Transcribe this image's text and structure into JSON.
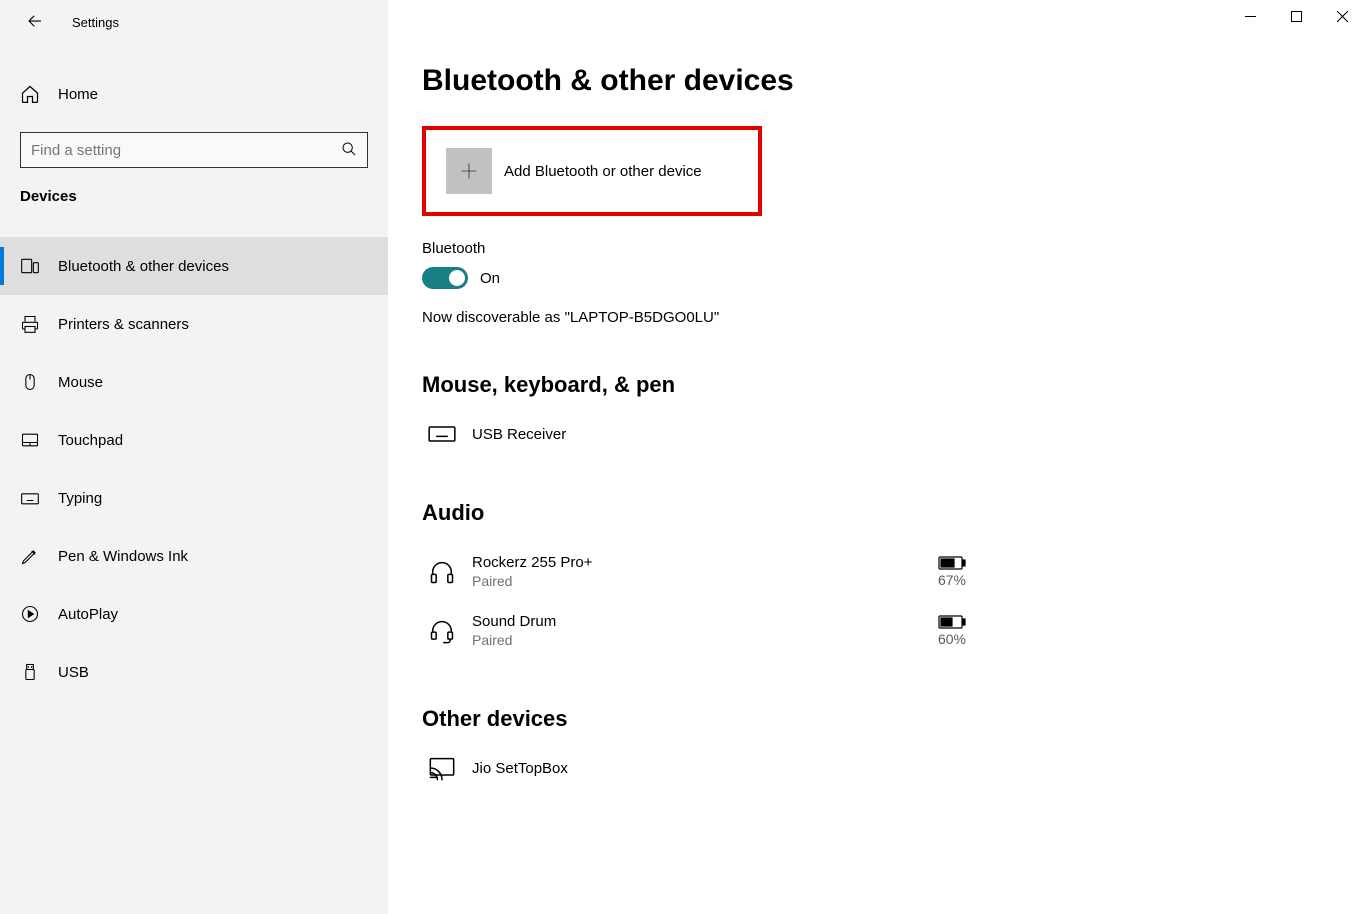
{
  "window": {
    "app_title": "Settings"
  },
  "sidebar": {
    "home_label": "Home",
    "search_placeholder": "Find a setting",
    "category_label": "Devices",
    "items": [
      {
        "label": "Bluetooth & other devices",
        "selected": true
      },
      {
        "label": "Printers & scanners"
      },
      {
        "label": "Mouse"
      },
      {
        "label": "Touchpad"
      },
      {
        "label": "Typing"
      },
      {
        "label": "Pen & Windows Ink"
      },
      {
        "label": "AutoPlay"
      },
      {
        "label": "USB"
      }
    ]
  },
  "page": {
    "title": "Bluetooth & other devices",
    "add_device_label": "Add Bluetooth or other device",
    "bluetooth_label": "Bluetooth",
    "bluetooth_state": "On",
    "discoverable_text": "Now discoverable as \"LAPTOP-B5DGO0LU\"",
    "sections": {
      "mouse_kb": {
        "title": "Mouse, keyboard, & pen",
        "devices": [
          {
            "name": "USB Receiver"
          }
        ]
      },
      "audio": {
        "title": "Audio",
        "devices": [
          {
            "name": "Rockerz 255 Pro+",
            "status": "Paired",
            "battery": "67%"
          },
          {
            "name": "Sound Drum",
            "status": "Paired",
            "battery": "60%"
          }
        ]
      },
      "other": {
        "title": "Other devices",
        "devices": [
          {
            "name": "Jio SetTopBox"
          }
        ]
      }
    }
  }
}
